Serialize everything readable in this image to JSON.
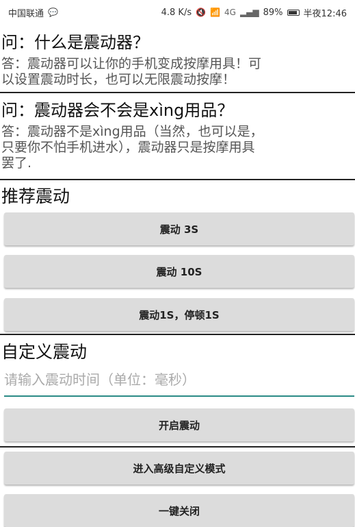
{
  "status_bar": {
    "carrier": "中国联通",
    "speed": "4.8 K/s",
    "network": "4G",
    "battery": "89%",
    "time": "半夜12:46"
  },
  "faq": [
    {
      "question": "问：什么是震动器？",
      "answer": "答：震动器可以让你的手机变成按摩用具！可\n以设置震动时长，也可以无限震动按摩！"
    },
    {
      "question": "问：震动器会不会是xìng用品？",
      "answer": "答：震动器不是xìng用品（当然，也可以是，\n只要你不怕手机进水），震动器只是按摩用具\n罢了."
    }
  ],
  "recommended": {
    "title": "推荐震动",
    "buttons": [
      "震动 3S",
      "震动 10S",
      "震动1S，停顿1S"
    ]
  },
  "custom": {
    "title": "自定义震动",
    "input_placeholder": "请输入震动时间（单位：毫秒）",
    "input_value": "",
    "start_button": "开启震动"
  },
  "advanced_button": "进入高级自定义模式",
  "stop_button": "一键关闭"
}
